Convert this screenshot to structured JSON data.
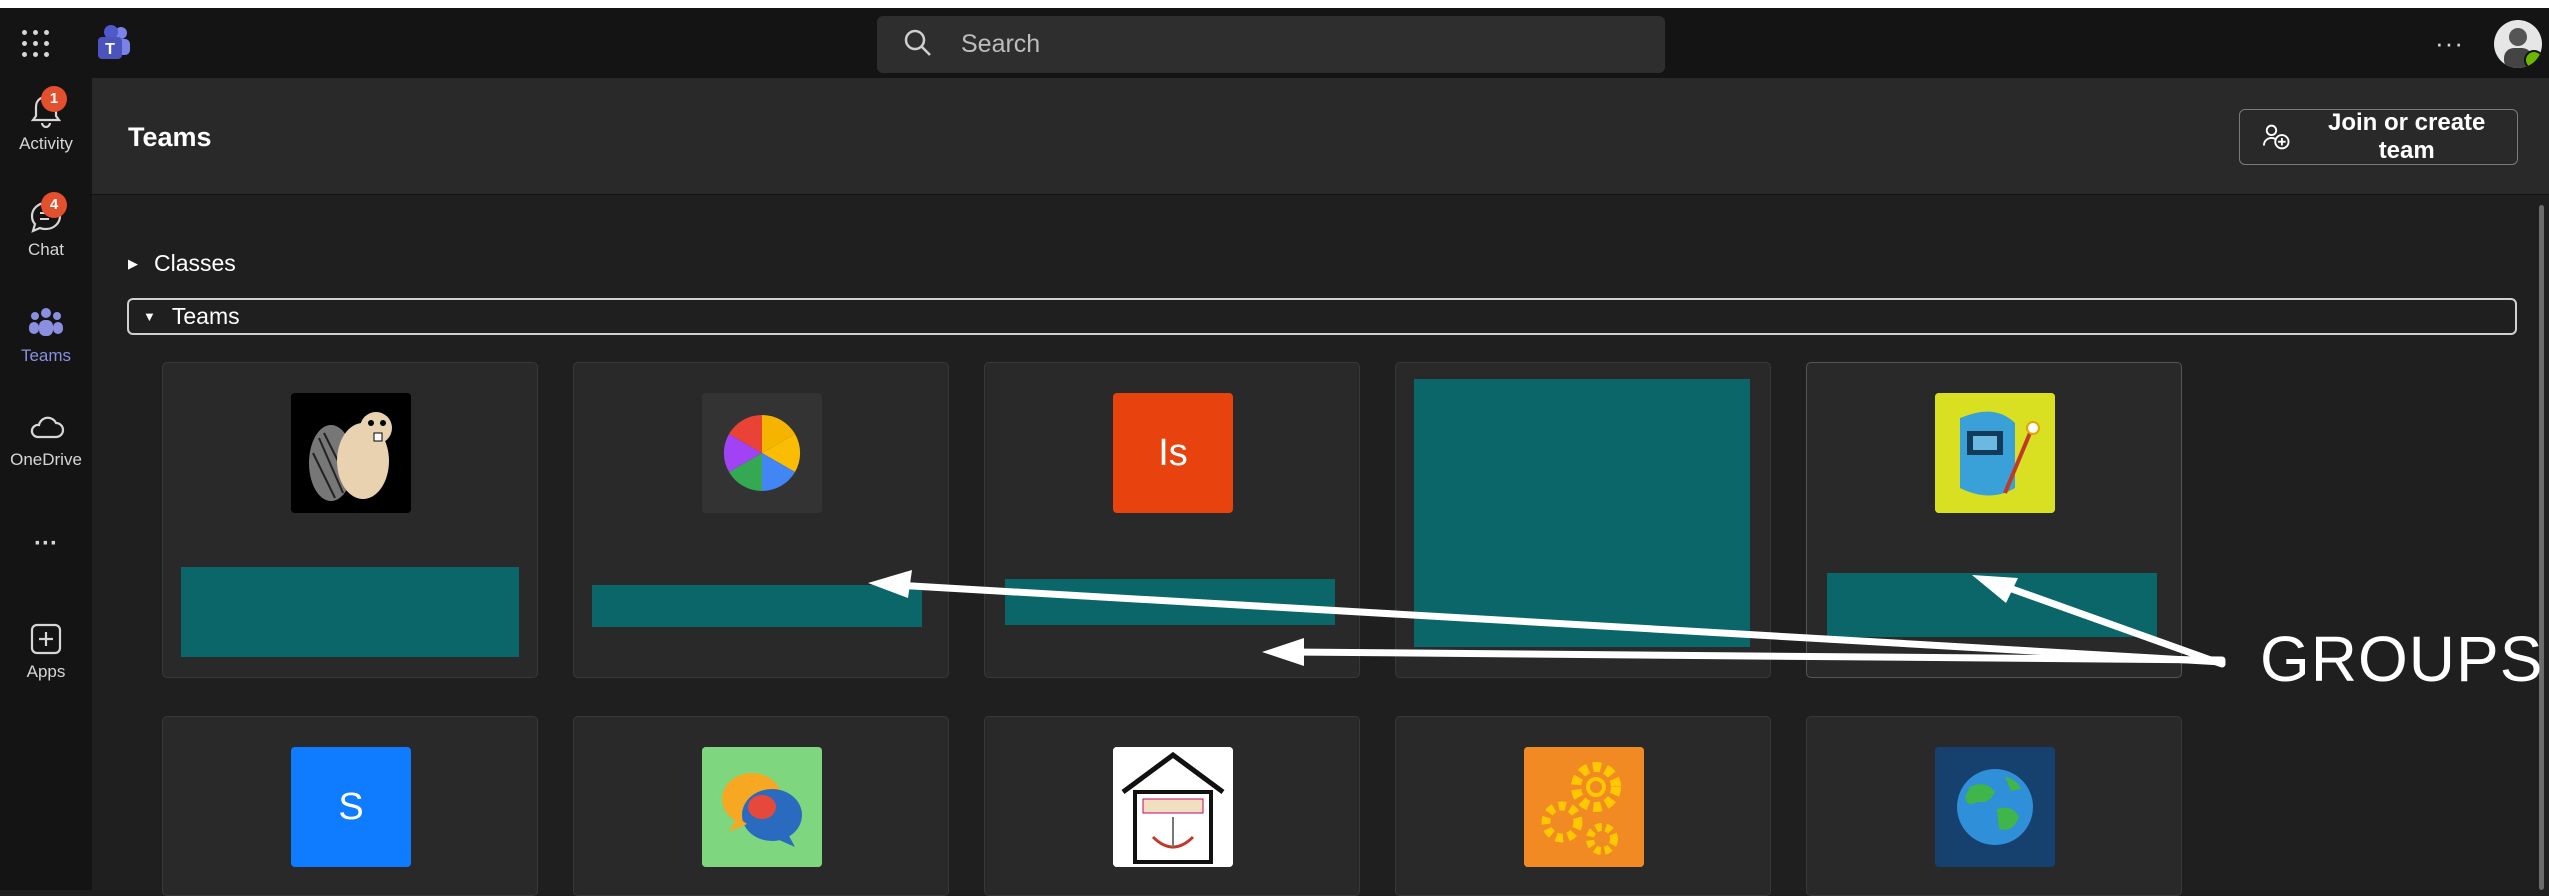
{
  "topbar": {
    "search_placeholder": "Search",
    "more_label": "···"
  },
  "rail": {
    "items": [
      {
        "label": "Activity",
        "badge": "1"
      },
      {
        "label": "Chat",
        "badge": "4"
      },
      {
        "label": "Teams"
      },
      {
        "label": "OneDrive"
      },
      {
        "label": "···"
      },
      {
        "label": "Apps"
      }
    ]
  },
  "header": {
    "title": "Teams",
    "more_label": "···",
    "join_button": "Join or create team"
  },
  "sections": {
    "classes": "Classes",
    "teams": "Teams"
  },
  "cards": [
    {
      "logo": "beaver-icon"
    },
    {
      "logo": "color-wheel-icon"
    },
    {
      "logo": "initials",
      "initials": "Is",
      "color": "#e8430f"
    },
    {
      "logo": "none"
    },
    {
      "logo": "welder-icon"
    },
    {
      "logo": "initials",
      "initials": "S",
      "color": "#0f7bff"
    },
    {
      "logo": "chat-bubbles-icon"
    },
    {
      "logo": "steam-house-icon"
    },
    {
      "logo": "gears-icon"
    },
    {
      "logo": "globe-icon"
    }
  ],
  "annotation": "GROUPS",
  "colors": {
    "accent": "#8a8fe0",
    "name_bar": "#0b6669",
    "badge": "#e3502d"
  }
}
